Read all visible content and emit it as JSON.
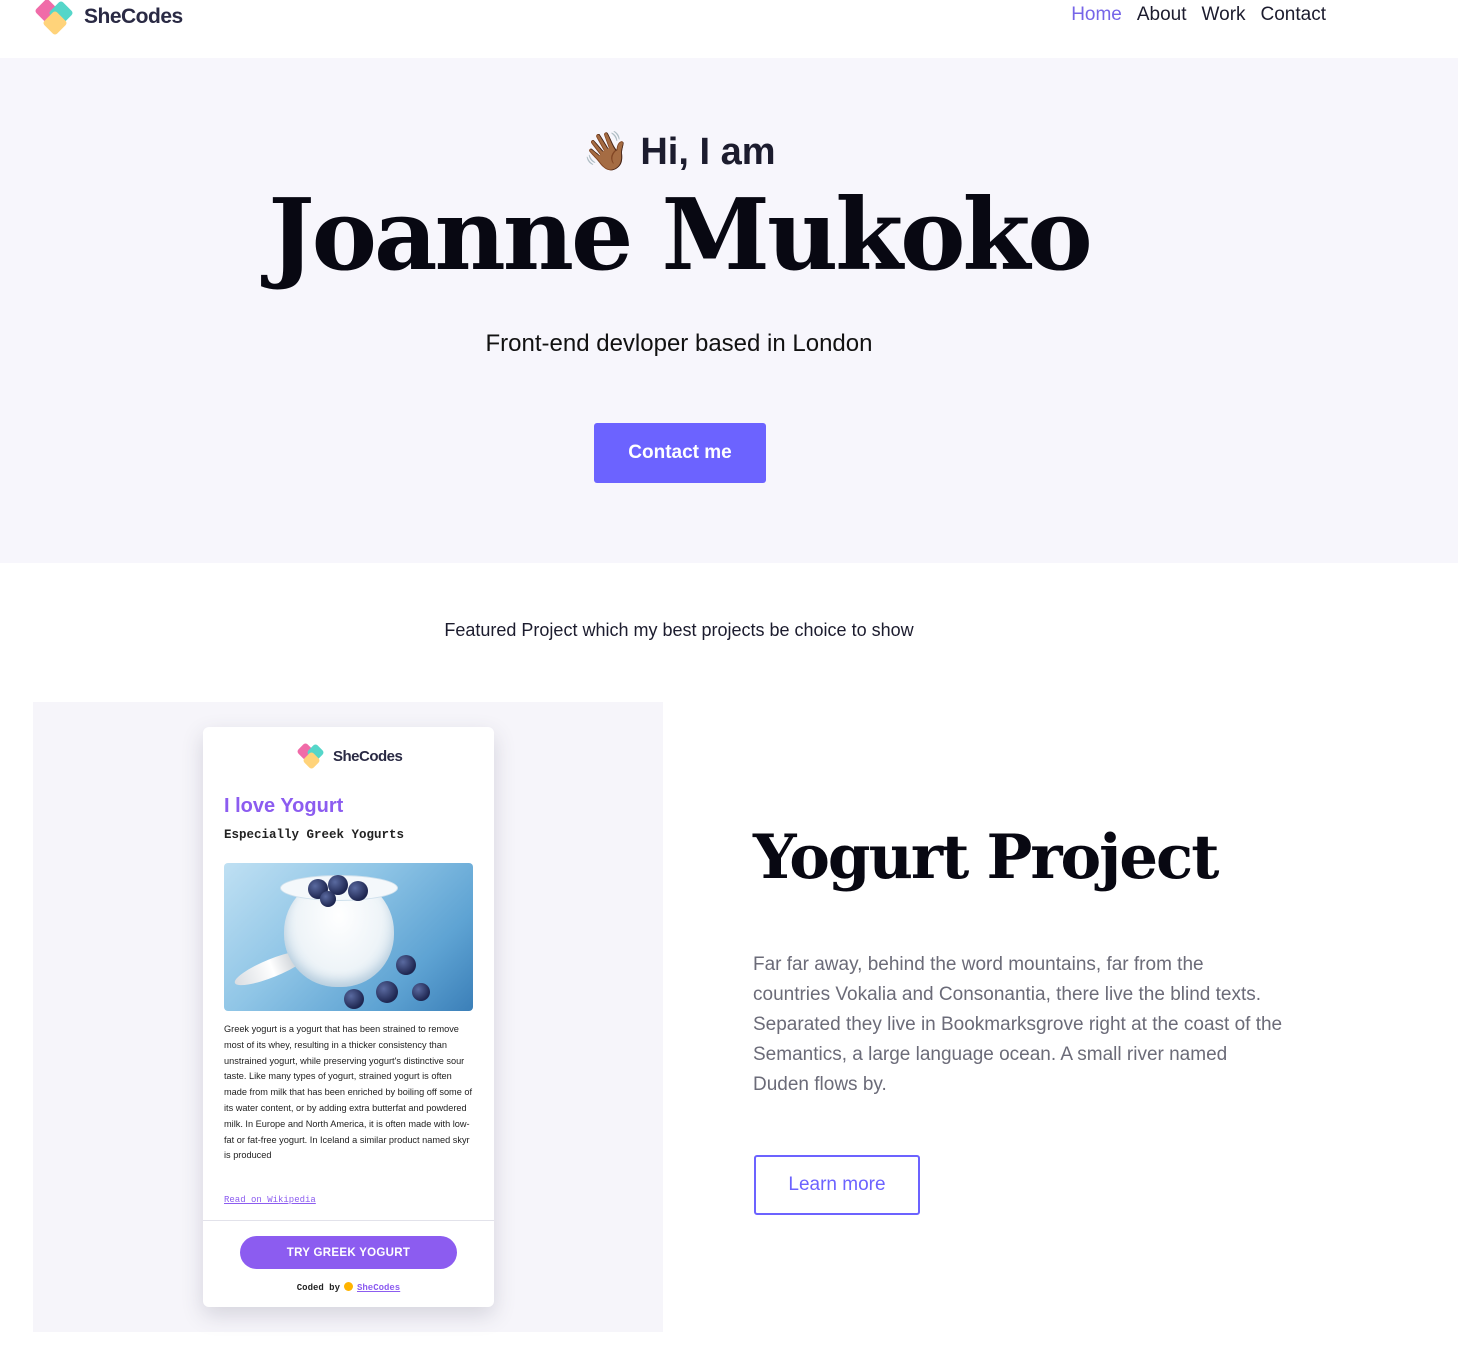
{
  "nav": {
    "logo_text": "SheCodes",
    "links": [
      {
        "label": "Home",
        "active": true
      },
      {
        "label": "About"
      },
      {
        "label": "Work"
      },
      {
        "label": "Contact"
      }
    ]
  },
  "hero": {
    "greeting_emoji": "👋🏾",
    "greeting": "Hi, I am",
    "name": "Joanne Mukoko",
    "subtitle": "Front-end devloper based in London",
    "cta_label": "Contact me"
  },
  "featured": {
    "intro": "Featured Project which my best projects be choice to show",
    "preview_card": {
      "logo_text": "SheCodes",
      "title": "I love Yogurt",
      "subtitle": "Especially Greek Yogurts",
      "image_icon": "yogurt-photo",
      "body": "Greek yogurt is a yogurt that has been strained to remove most of its whey, resulting in a thicker consistency than unstrained yogurt, while preserving yogurt's distinctive sour taste. Like many types of yogurt, strained yogurt is often made from milk that has been enriched by boiling off some of its water content, or by adding extra butterfat and powdered milk. In Europe and North America, it is often made with low-fat or fat-free yogurt. In Iceland a similar product named skyr is produced",
      "wiki_link": "Read on Wikipedia",
      "cta_label": "TRY GREEK YOGURT",
      "footer_prefix": "Coded by",
      "footer_link": "SheCodes"
    },
    "project_title": "Yogurt Project",
    "project_description": "Far far away, behind the word mountains, far from the countries Vokalia and Consonantia, there live the blind texts. Separated they live in Bookmarksgrove right at the coast of the Semantics, a large language ocean. A small river named Duden flows by.",
    "learn_more_label": "Learn more"
  },
  "colors": {
    "accent": "#6c63ff",
    "nav_active": "#7665e8",
    "card_accent": "#8c5cf0",
    "hero_bg": "#f7f6fc"
  }
}
